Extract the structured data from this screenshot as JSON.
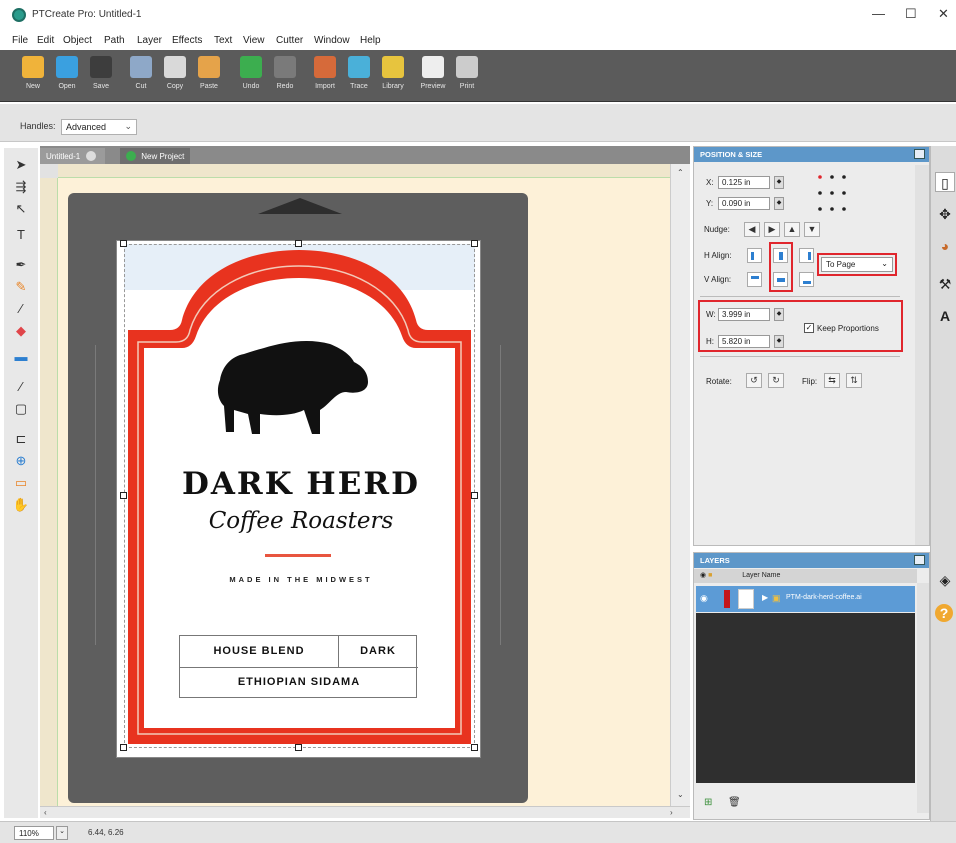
{
  "window": {
    "title": "PTCreate Pro: Untitled-1",
    "minimize": "—",
    "maximize": "☐",
    "close": "✕"
  },
  "menu": [
    "File",
    "Edit",
    "Object",
    "Path",
    "Layer",
    "Effects",
    "Text",
    "View",
    "Cutter",
    "Window",
    "Help"
  ],
  "toolbar": [
    {
      "label": "New",
      "icon": "new-doc-icon",
      "color": "#f0b33a"
    },
    {
      "label": "Open",
      "icon": "open-folder-icon",
      "color": "#3aa0e0"
    },
    {
      "label": "Save",
      "icon": "save-icon",
      "color": "#3d3d3d"
    },
    {
      "label": "Cut",
      "icon": "cut-icon",
      "color": "#8ea8c8"
    },
    {
      "label": "Copy",
      "icon": "copy-icon",
      "color": "#d9d9d9"
    },
    {
      "label": "Paste",
      "icon": "paste-icon",
      "color": "#e5a34a"
    },
    {
      "label": "Undo",
      "icon": "undo-icon",
      "color": "#3cae4f"
    },
    {
      "label": "Redo",
      "icon": "redo-icon",
      "color": "#7a7a7a"
    },
    {
      "label": "Import",
      "icon": "import-icon",
      "color": "#d66a3a"
    },
    {
      "label": "Trace",
      "icon": "trace-icon",
      "color": "#4ab0d9"
    },
    {
      "label": "Library",
      "icon": "library-icon",
      "color": "#e7c43e"
    },
    {
      "label": "Preview",
      "icon": "preview-icon",
      "color": "#eeeeee"
    },
    {
      "label": "Print",
      "icon": "print-icon",
      "color": "#cccccc"
    }
  ],
  "handles": {
    "label": "Handles:",
    "value": "Advanced"
  },
  "tabs": {
    "untitled": "Untitled-1",
    "new_project": "New Project"
  },
  "label": {
    "heading": "DARK HERD",
    "script": "Coffee Roasters",
    "tagline": "MADE IN THE MIDWEST",
    "blend": "HOUSE BLEND",
    "roast": "DARK",
    "origin": "ETHIOPIAN SIDAMA"
  },
  "position_size": {
    "title": "POSITION & SIZE",
    "x_label": "X:",
    "x_value": "0.125 in",
    "y_label": "Y:",
    "y_value": "0.090 in",
    "nudge_label": "Nudge:",
    "halign_label": "H Align:",
    "valign_label": "V Align:",
    "align_to": "To Page",
    "w_label": "W:",
    "w_value": "3.999 in",
    "h_label": "H:",
    "h_value": "5.820 in",
    "keep_proportions": "Keep Proportions",
    "rotate_label": "Rotate:",
    "flip_label": "Flip:"
  },
  "layers": {
    "title": "LAYERS",
    "column": "Layer Name",
    "layer_name": "PTM-dark-herd-coffee.ai"
  },
  "status": {
    "zoom": "110%",
    "coords": "6.44, 6.26"
  }
}
